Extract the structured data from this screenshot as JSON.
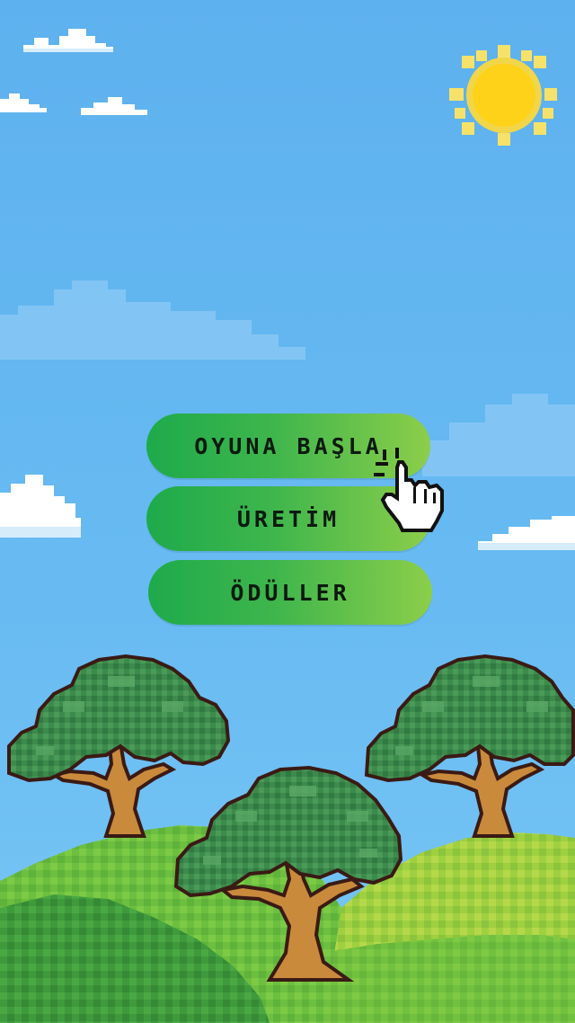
{
  "menu": {
    "start_label": "OYUNA BAŞLA",
    "production_label": "ÜRETİM",
    "rewards_label": "ÖDÜLLER"
  },
  "icons": {
    "pointer": "hand-pointer-icon",
    "sun": "sun-icon"
  },
  "colors": {
    "sky": "#5fb3ef",
    "button_start": "#1eaa4b",
    "button_end": "#8cce4a",
    "label": "#0d1a10",
    "sun": "#ffd21a"
  }
}
